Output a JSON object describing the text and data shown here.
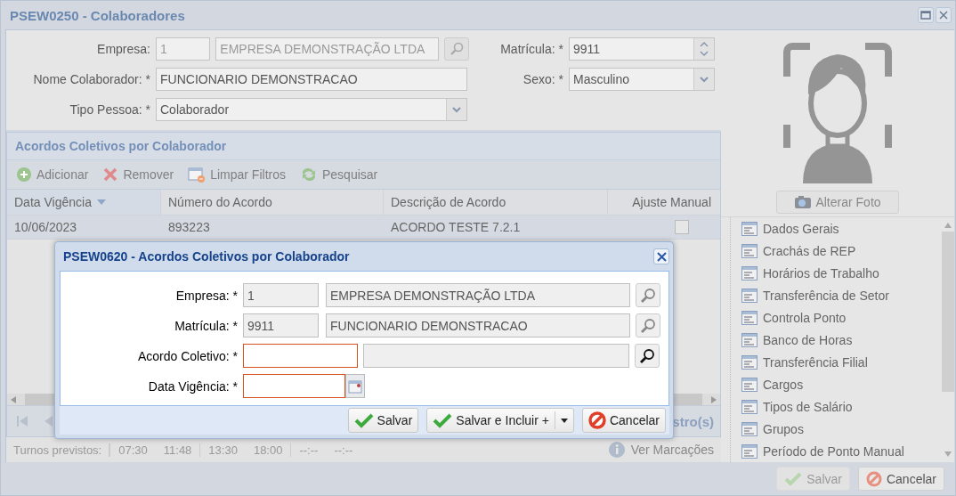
{
  "window": {
    "title": "PSEW0250 - Colaboradores"
  },
  "form": {
    "empresa": {
      "label": "Empresa:",
      "code": "1",
      "name": "EMPRESA DEMONSTRAÇÃO LTDA"
    },
    "matricula": {
      "label": "Matrícula: *",
      "value": "9911"
    },
    "nome": {
      "label": "Nome Colaborador: *",
      "value": "FUNCIONARIO DEMONSTRACAO"
    },
    "sexo": {
      "label": "Sexo: *",
      "value": "Masculino"
    },
    "tipo": {
      "label": "Tipo Pessoa: *",
      "value": "Colaborador"
    }
  },
  "grid": {
    "title": "Acordos Coletivos por Colaborador",
    "toolbar": [
      {
        "label": "Adicionar",
        "kind": "add"
      },
      {
        "label": "Remover",
        "kind": "remove"
      },
      {
        "label": "Limpar Filtros",
        "kind": "clear"
      },
      {
        "label": "Pesquisar",
        "kind": "refresh"
      }
    ],
    "columns": [
      {
        "label": "Data Vigência",
        "sorted": true
      },
      {
        "label": "Número do Acordo",
        "sorted": false
      },
      {
        "label": "Descrição de Acordo",
        "sorted": false
      },
      {
        "label": "Ajuste Manual",
        "sorted": false
      }
    ],
    "rows": [
      {
        "cells": [
          "10/06/2023",
          "893223",
          "ACORDO TESTE 7.2.1"
        ],
        "ajuste_manual": false
      }
    ],
    "paging_text": "stro(s)"
  },
  "turnos": {
    "label": "Turnos previstos:",
    "times": [
      "07:30",
      "11:48",
      "13:30",
      "18:00",
      "--:--",
      "--:--"
    ],
    "link": "Ver Marcações"
  },
  "side": {
    "photo_button": "Alterar Foto",
    "menu": [
      "Dados Gerais",
      "Crachás de REP",
      "Horários de Trabalho",
      "Transferência de Setor",
      "Controla Ponto",
      "Banco de Horas",
      "Transferência Filial",
      "Cargos",
      "Tipos de Salário",
      "Grupos",
      "Período de Ponto Manual"
    ]
  },
  "bottom_buttons": [
    {
      "label": "Salvar",
      "kind": "save",
      "disabled": true
    },
    {
      "label": "Cancelar",
      "kind": "cancel",
      "disabled": false
    }
  ],
  "dialog": {
    "title": "PSEW0620 - Acordos Coletivos por Colaborador",
    "fields": [
      {
        "kind": "lookup",
        "label": "Empresa: *",
        "code": "1",
        "name": "EMPRESA DEMONSTRAÇÃO LTDA",
        "disabled": true,
        "invalid": false
      },
      {
        "kind": "lookup",
        "label": "Matrícula: *",
        "code": "9911",
        "name": "FUNCIONARIO DEMONSTRACAO",
        "disabled": true,
        "invalid": false
      },
      {
        "kind": "lookup",
        "label": "Acordo Coletivo: *",
        "disabled": false,
        "invalid": true
      },
      {
        "kind": "date",
        "label": "Data Vigência: *",
        "invalid": true
      }
    ],
    "buttons": [
      {
        "label": "Salvar",
        "kind": "save"
      },
      {
        "label": "Salvar e Incluir +",
        "kind": "split"
      },
      {
        "label": "Cancelar",
        "kind": "cancel"
      }
    ]
  }
}
